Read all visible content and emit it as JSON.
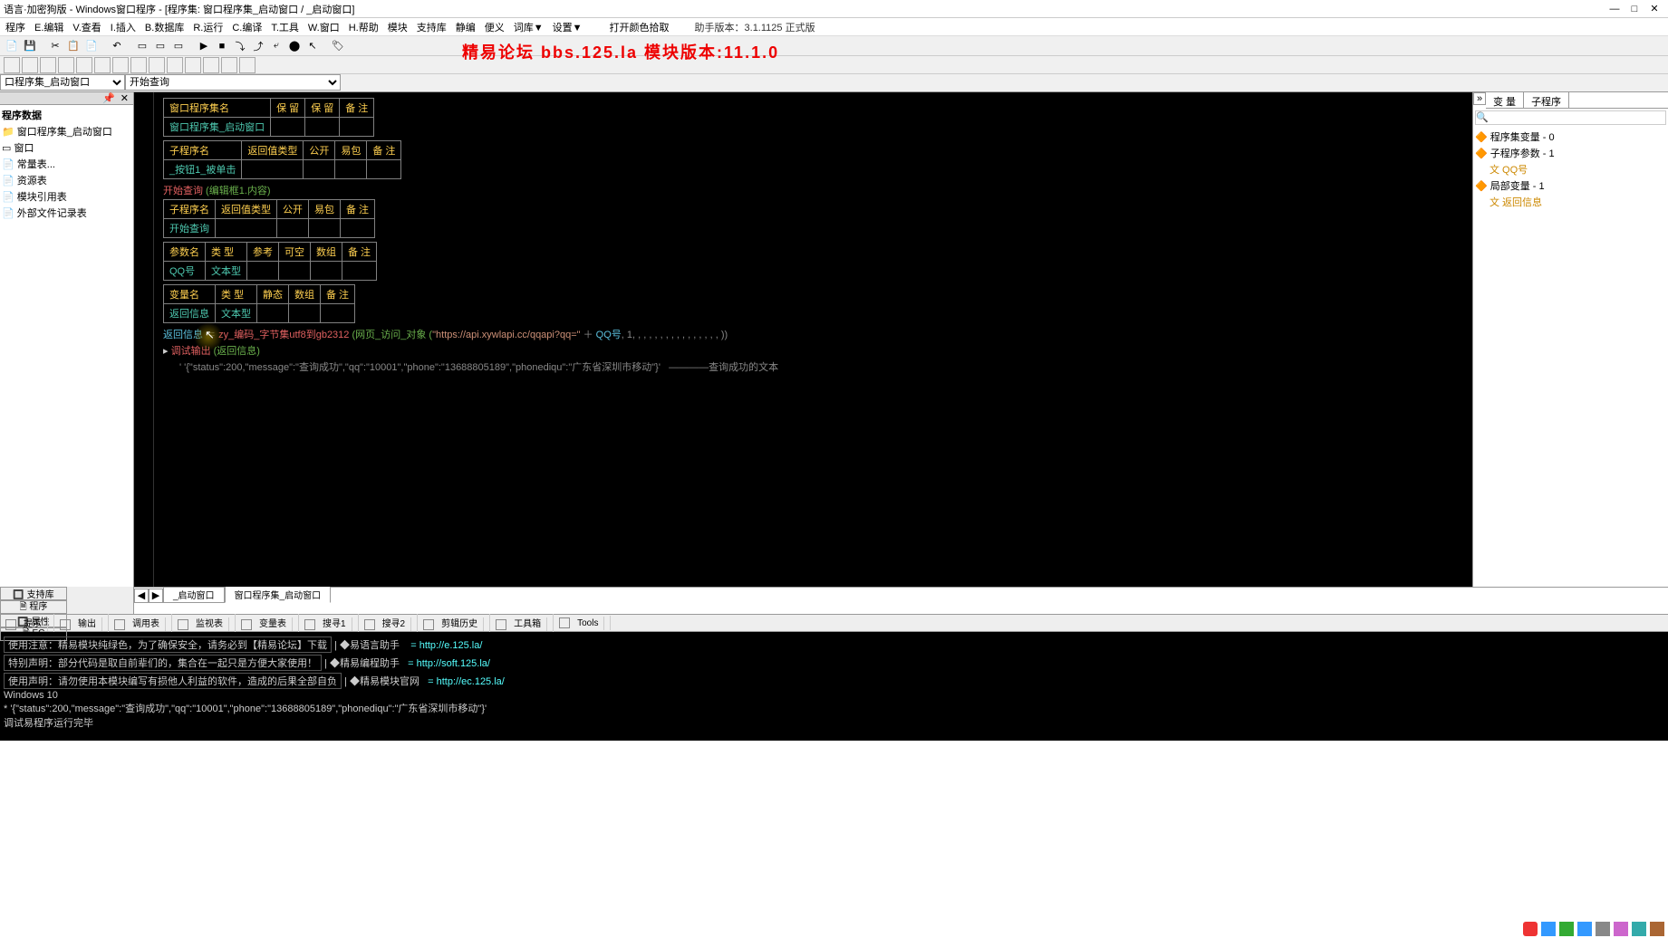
{
  "window": {
    "title": "语言·加密狗版 - Windows窗口程序 - [程序集: 窗口程序集_启动窗口 / _启动窗口]",
    "min": "—",
    "max": "□",
    "close": "✕"
  },
  "menu": {
    "items": [
      "程序",
      "E.编辑",
      "V.查看",
      "I.插入",
      "B.数据库",
      "R.运行",
      "C.编译",
      "T.工具",
      "W.窗口",
      "H.帮助",
      "模块",
      "支持库",
      "静编",
      "便义",
      "词库▼",
      "设置▼",
      "",
      "打开颜色拾取"
    ],
    "version": "助手版本：3.1.1125 正式版"
  },
  "banner": "精易论坛 bbs.125.la 模块版本:11.1.0",
  "combos": {
    "c1": "口程序集_启动窗口",
    "c2": "开始查询"
  },
  "leftTree": {
    "root": "程序数据",
    "items": [
      "窗口程序集_启动窗口",
      "窗口",
      "常量表...",
      "资源表",
      "模块引用表",
      "外部文件记录表"
    ]
  },
  "leftTabs": [
    "🔲 支持库",
    "🗎 程序",
    "🔲 属性",
    "🗎 EC"
  ],
  "editor": {
    "tbl1": {
      "h": [
        "窗口程序集名",
        "保 留",
        "保 留",
        "备 注"
      ],
      "r": "窗口程序集_启动窗口"
    },
    "tbl2": {
      "h": [
        "子程序名",
        "返回值类型",
        "公开",
        "易包",
        "备 注"
      ],
      "r": "_按钮1_被单击"
    },
    "line1_a": "开始查询",
    "line1_b": " (编辑框1.内容)",
    "tbl3": {
      "h": [
        "子程序名",
        "返回值类型",
        "公开",
        "易包",
        "备 注"
      ],
      "r": "开始查询"
    },
    "tbl4": {
      "h": [
        "参数名",
        "类 型",
        "参考",
        "可空",
        "数组",
        "备 注"
      ],
      "r1": "QQ号",
      "r2": "文本型"
    },
    "tbl5": {
      "h": [
        "变量名",
        "类 型",
        "静态",
        "数组",
        "备 注"
      ],
      "r1": "返回信息",
      "r2": "文本型"
    },
    "code1_a": "返回信息",
    "code1_b": " ＝ ",
    "code1_c": "zy_编码_字节集utf8到gb2312",
    "code1_d": " (网页_访问_对象 (",
    "code1_e": "\"https://api.xywlapi.cc/qqapi?qq=\"",
    "code1_f": " ＋ ",
    "code1_g": "QQ号",
    "code1_h": ", 1, , , , , , , , , , , , , , , , ))",
    "code2_a": "调试输出",
    "code2_b": " (返回信息)",
    "code3": "' '{\"status\":200,\"message\":\"查询成功\",\"qq\":\"10001\",\"phone\":\"13688805189\",\"phonediqu\":\"广东省深圳市移动\"}'   ————查询成功的文本"
  },
  "editorTabs": {
    "t1": "_启动窗口",
    "t2": "窗口程序集_启动窗口"
  },
  "right": {
    "tabs": [
      "变 量",
      "子程序"
    ],
    "searchPlaceholder": "🔍",
    "tree": [
      "🔶 程序集变量 - 0",
      "🔶 子程序参数 - 1",
      "   文 QQ号",
      "🔶 局部变量 - 1",
      "   文 返回信息"
    ]
  },
  "bottomTabs": [
    "提示",
    "输出",
    "调用表",
    "监视表",
    "变量表",
    "搜寻1",
    "搜寻2",
    "剪辑历史",
    "工具箱",
    "Tools"
  ],
  "console": {
    "l1a": "使用注意：精易模块纯绿色，为了确保安全，请务必到【精易论坛】下载",
    "l1b": "◆易语言助手",
    "l1c": "= http://e.125.la/",
    "l2a": "特别声明：部分代码是取自前辈们的，集合在一起只是方便大家使用！",
    "l2b": "◆精易编程助手",
    "l2c": "= http://soft.125.la/",
    "l3a": "使用声明：请勿使用本模块编写有损他人利益的软件，造成的后果全部自负",
    "l3b": "◆精易模块官网",
    "l3c": "= http://ec.125.la/",
    "l4": "Windows 10",
    "l5": "* '{\"status\":200,\"message\":\"查询成功\",\"qq\":\"10001\",\"phone\":\"13688805189\",\"phonediqu\":\"广东省深圳市移动\"}'",
    "l6": "调试易程序运行完毕"
  }
}
